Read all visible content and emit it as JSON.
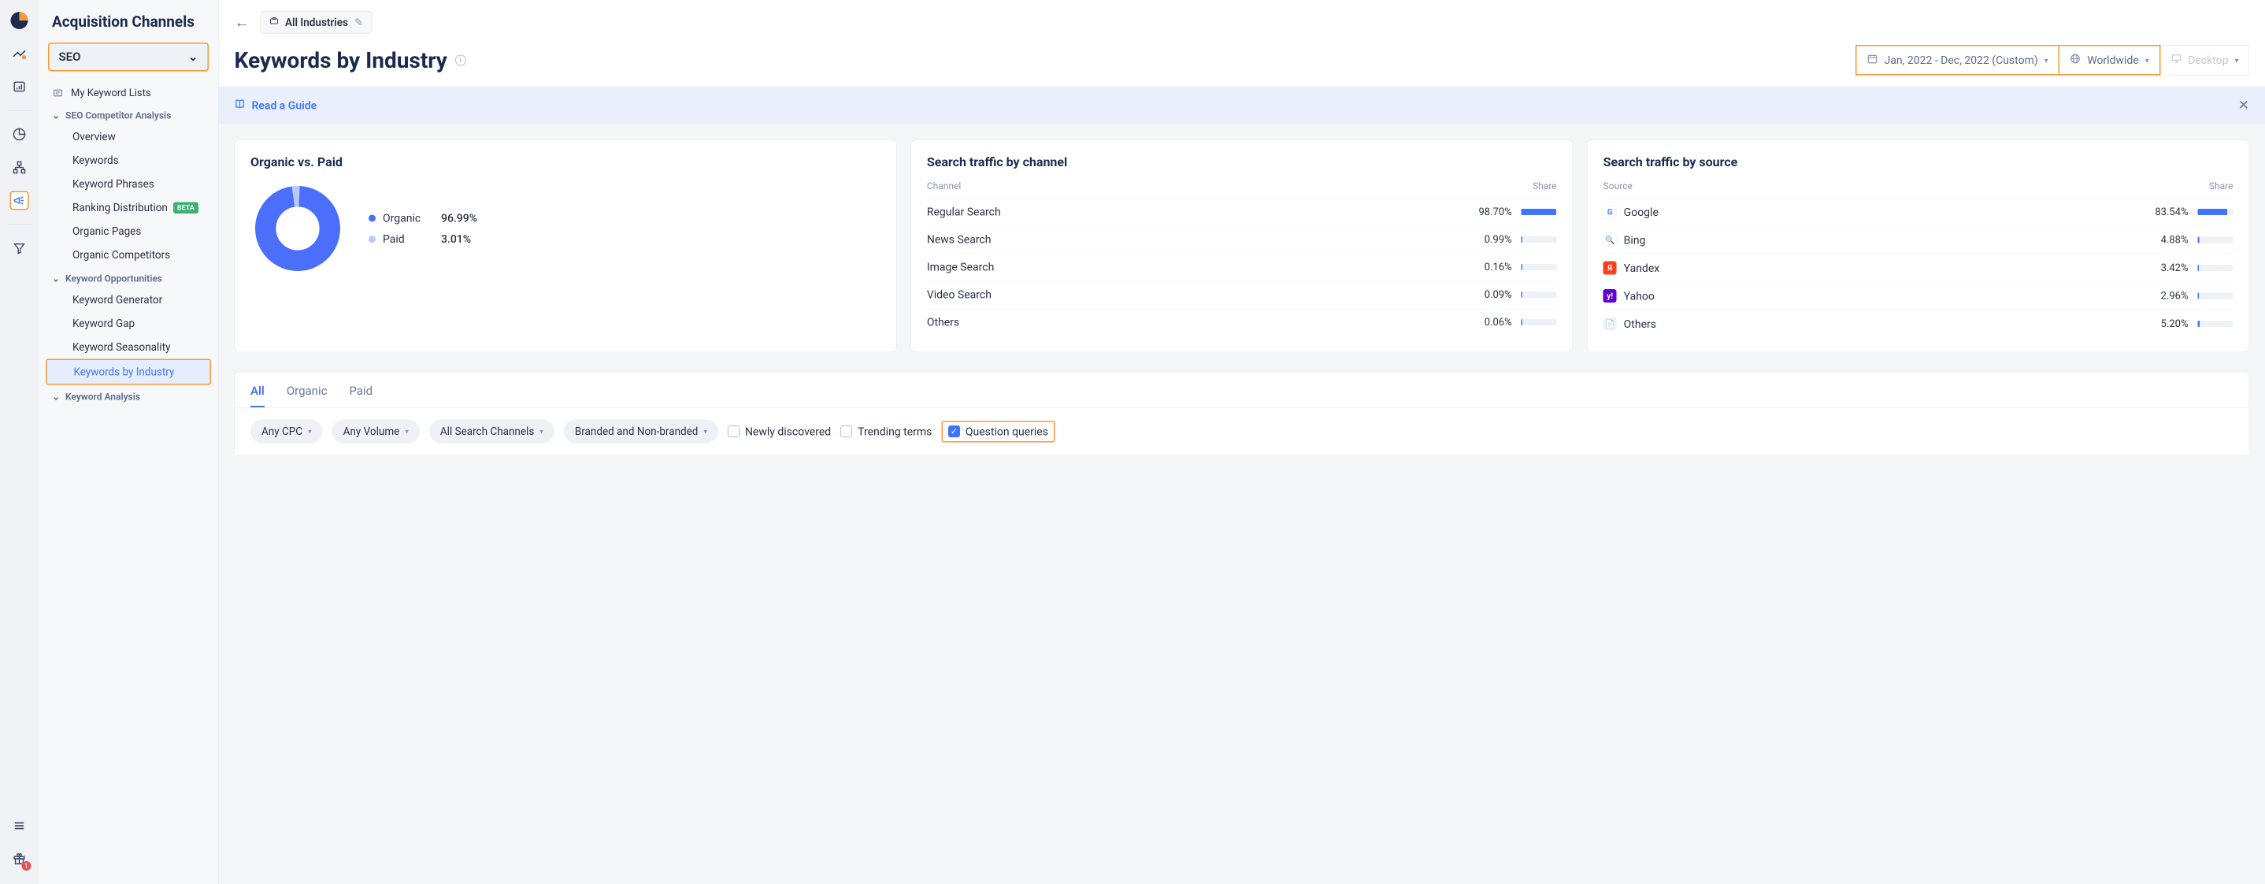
{
  "sidebar": {
    "title": "Acquisition Channels",
    "dropdown": "SEO",
    "my_lists": "My Keyword Lists",
    "sections": {
      "competitor": {
        "label": "SEO Competitor Analysis",
        "items": [
          "Overview",
          "Keywords",
          "Keyword Phrases",
          "Ranking Distribution",
          "Organic Pages",
          "Organic Competitors"
        ],
        "beta_index": 3,
        "beta_label": "BETA"
      },
      "opportunities": {
        "label": "Keyword Opportunities",
        "items": [
          "Keyword Generator",
          "Keyword Gap",
          "Keyword Seasonality",
          "Keywords by Industry"
        ],
        "active_index": 3
      },
      "analysis": {
        "label": "Keyword Analysis"
      }
    }
  },
  "topbar": {
    "industry": "All Industries"
  },
  "header": {
    "title": "Keywords by Industry",
    "date_range": "Jan, 2022 - Dec, 2022 (Custom)",
    "region": "Worldwide",
    "device": "Desktop"
  },
  "guide": {
    "label": "Read a Guide"
  },
  "cards": {
    "organic_paid": {
      "title": "Organic vs. Paid",
      "organic_label": "Organic",
      "organic_pct": "96.99%",
      "paid_label": "Paid",
      "paid_pct": "3.01%"
    },
    "channel": {
      "title": "Search traffic by channel",
      "col1": "Channel",
      "col2": "Share",
      "rows": [
        {
          "name": "Regular Search",
          "pct": "98.70%",
          "fill": 98.7
        },
        {
          "name": "News Search",
          "pct": "0.99%",
          "fill": 0.99
        },
        {
          "name": "Image Search",
          "pct": "0.16%",
          "fill": 0.16
        },
        {
          "name": "Video Search",
          "pct": "0.09%",
          "fill": 0.09
        },
        {
          "name": "Others",
          "pct": "0.06%",
          "fill": 0.06
        }
      ]
    },
    "source": {
      "title": "Search traffic by source",
      "col1": "Source",
      "col2": "Share",
      "rows": [
        {
          "name": "Google",
          "pct": "83.54%",
          "fill": 83.54,
          "icon": "G",
          "bg": "#fff",
          "color": "#4285f4",
          "border": "1px solid #e4e7ed"
        },
        {
          "name": "Bing",
          "pct": "4.88%",
          "fill": 4.88,
          "icon": "🔍",
          "bg": "#fff",
          "color": "#008373",
          "border": "1px solid #e4e7ed"
        },
        {
          "name": "Yandex",
          "pct": "3.42%",
          "fill": 3.42,
          "icon": "Я",
          "bg": "#fc3f1d",
          "color": "#fff",
          "border": "none"
        },
        {
          "name": "Yahoo",
          "pct": "2.96%",
          "fill": 2.96,
          "icon": "y!",
          "bg": "#5f01d1",
          "color": "#fff",
          "border": "none"
        },
        {
          "name": "Others",
          "pct": "5.20%",
          "fill": 5.2,
          "icon": "📄",
          "bg": "#f0f2f6",
          "color": "#8a94ab",
          "border": "none"
        }
      ]
    }
  },
  "chart_data": {
    "type": "pie",
    "title": "Organic vs. Paid",
    "series": [
      {
        "name": "Organic",
        "value": 96.99,
        "color": "#4b6ffb"
      },
      {
        "name": "Paid",
        "value": 3.01,
        "color": "#b9c9fc"
      }
    ]
  },
  "tabs": {
    "items": [
      "All",
      "Organic",
      "Paid"
    ],
    "active": 0
  },
  "chips": [
    "Any CPC",
    "Any Volume",
    "All Search Channels",
    "Branded and Non-branded"
  ],
  "checks": {
    "newly": "Newly discovered",
    "trending": "Trending terms",
    "question": "Question queries"
  },
  "rail": {
    "gift_badge": "1"
  }
}
